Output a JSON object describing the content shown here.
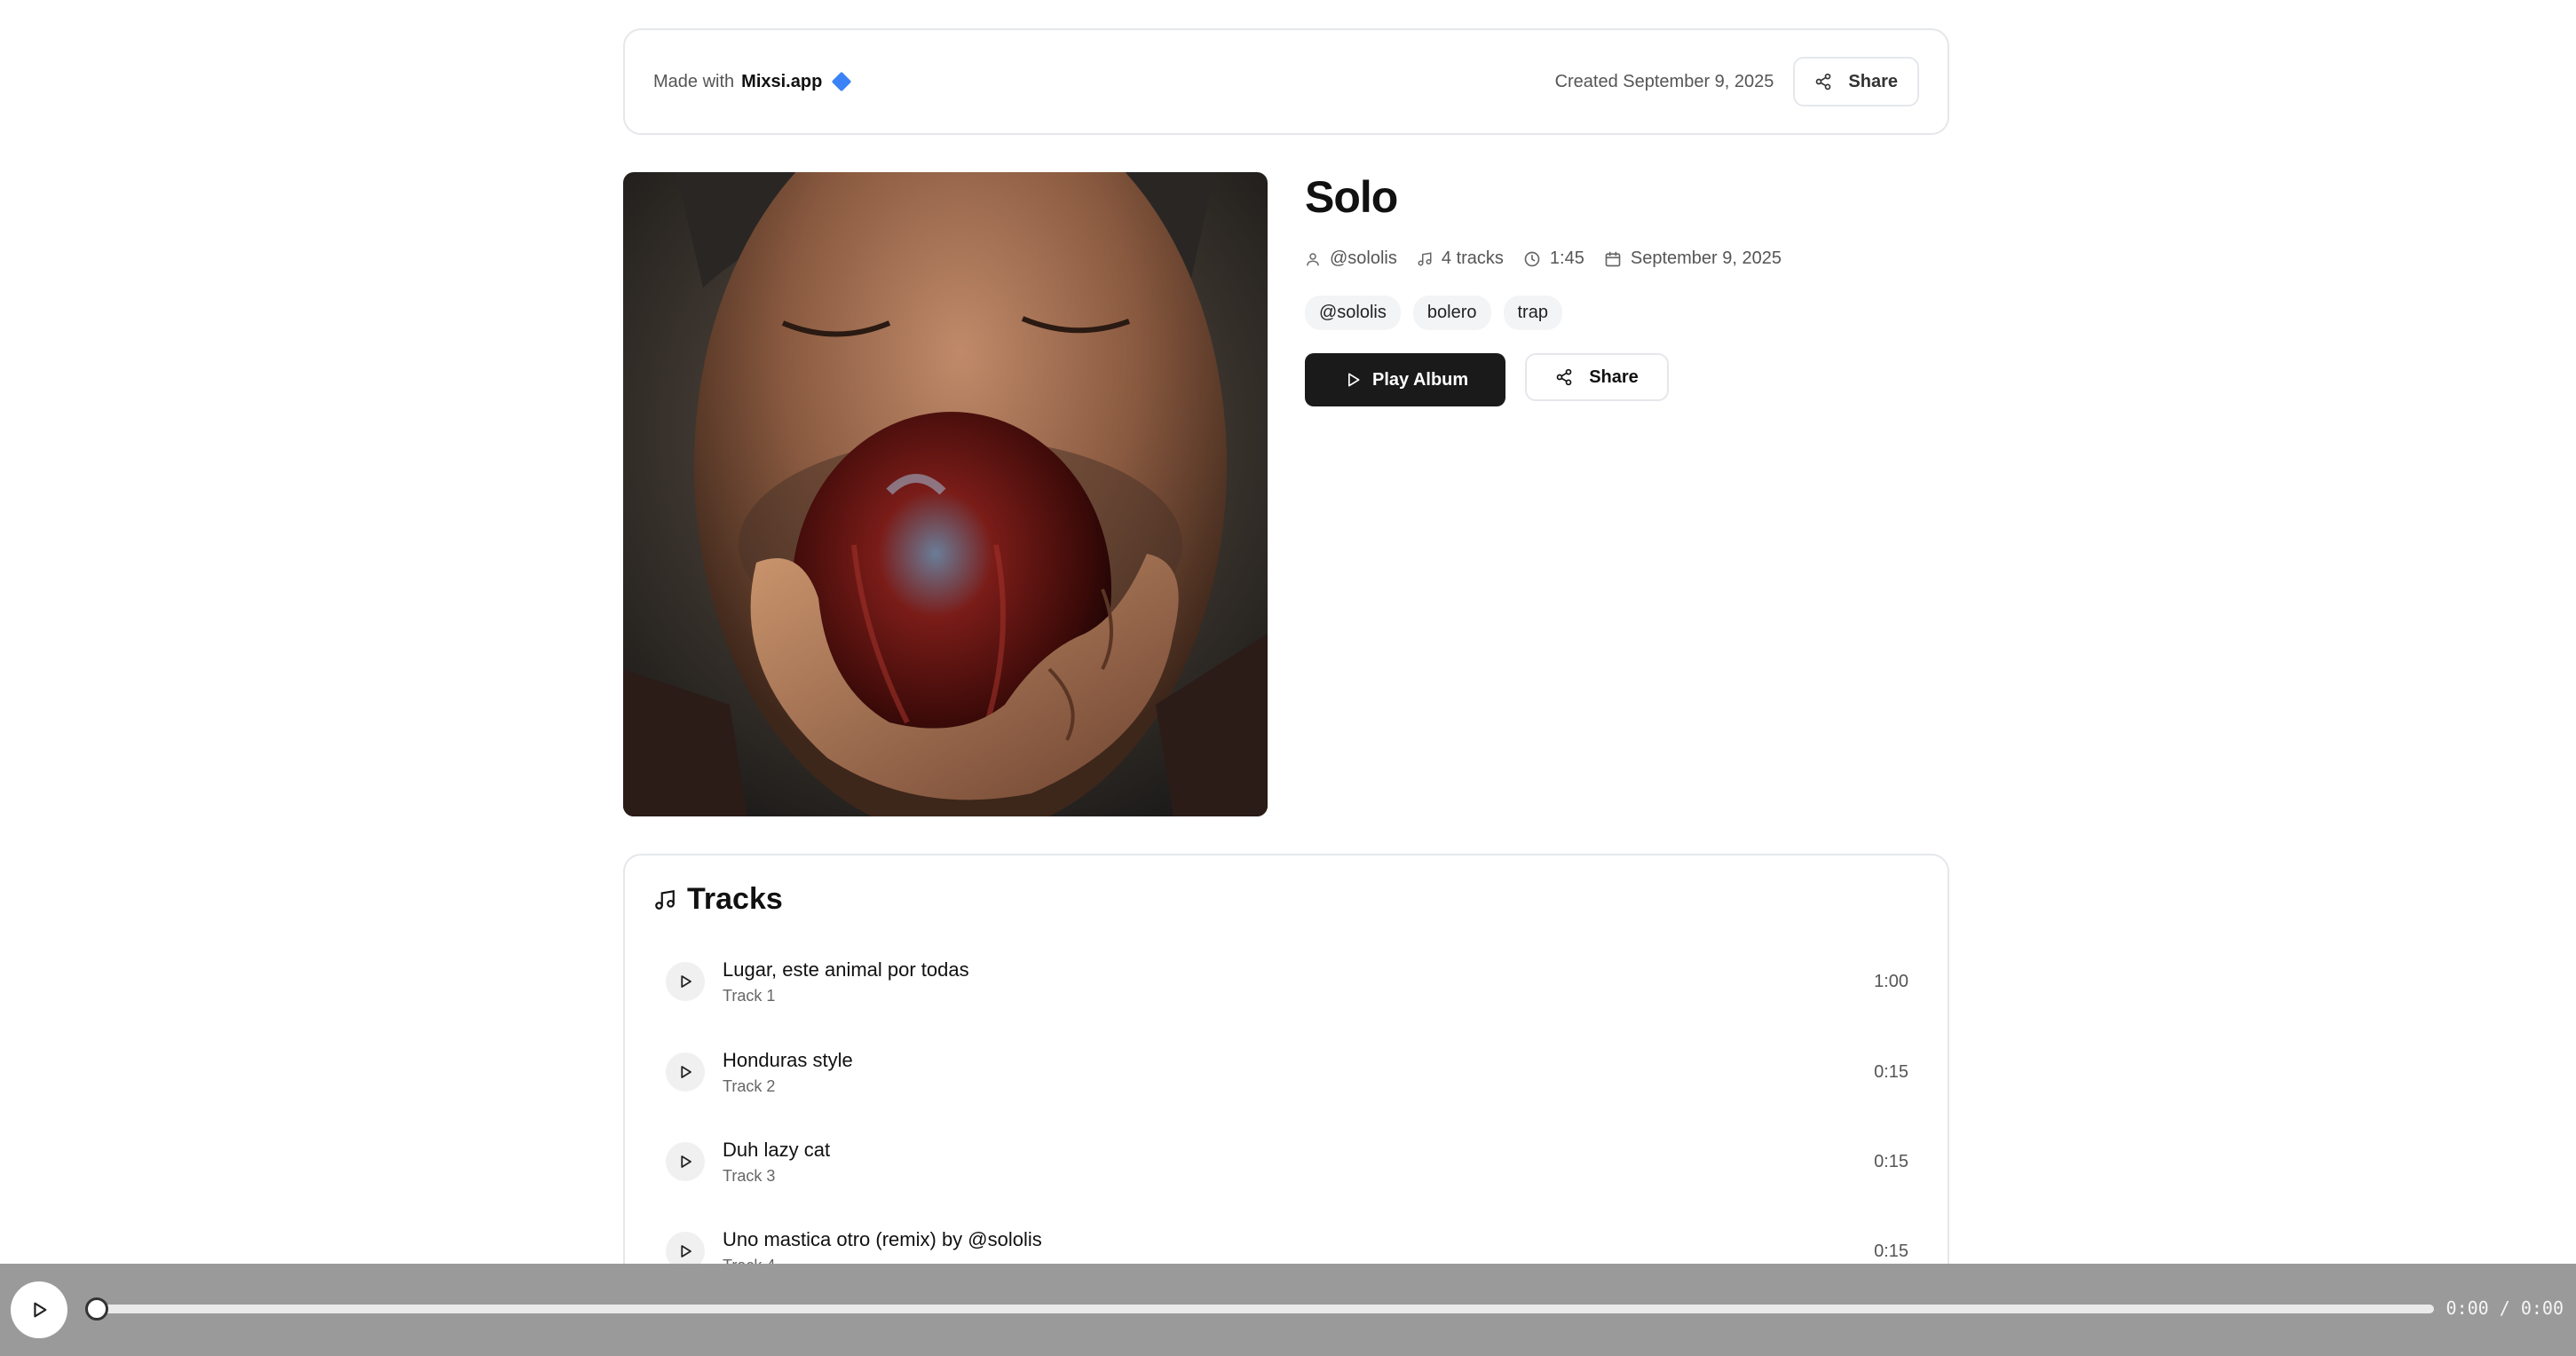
{
  "header": {
    "made_with_prefix": "Made with",
    "brand": "Mixsi.app",
    "created": "Created September 9, 2025",
    "share_label": "Share"
  },
  "album": {
    "title": "Solo",
    "artist": "@sololis",
    "track_count": "4 tracks",
    "duration": "1:45",
    "date": "September 9, 2025",
    "tags": [
      "@sololis",
      "bolero",
      "trap"
    ],
    "play_label": "Play Album",
    "share_label": "Share",
    "cover_icon": "album-cover-image"
  },
  "tracks": {
    "title": "Tracks",
    "items": [
      {
        "name": "Lugar, este animal por todas",
        "number": "Track 1",
        "duration": "1:00"
      },
      {
        "name": "Honduras style",
        "number": "Track 2",
        "duration": "0:15"
      },
      {
        "name": "Duh lazy cat",
        "number": "Track 3",
        "duration": "0:15"
      },
      {
        "name": "Uno mastica otro (remix) by @sololis",
        "number": "Track 4",
        "duration": "0:15"
      }
    ]
  },
  "player": {
    "time": "0:00 / 0:00",
    "progress": 0
  },
  "colors": {
    "primary_button": "#1a1a1a",
    "brand_diamond": "#3b82f6",
    "player_bar": "#9a9a9a"
  }
}
